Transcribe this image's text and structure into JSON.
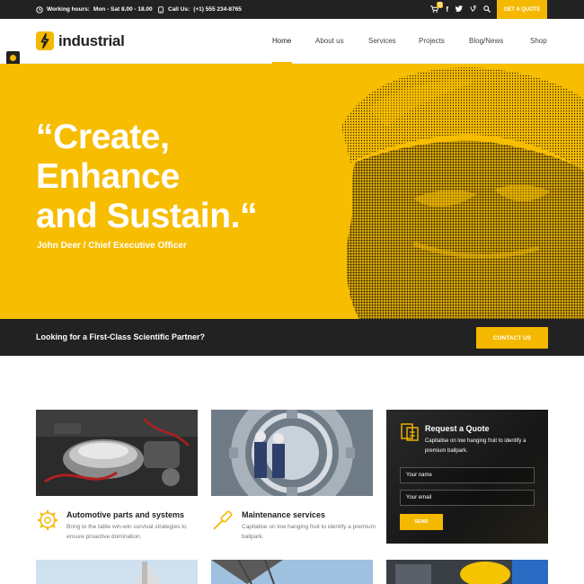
{
  "topbar": {
    "hours_label": "Working hours:",
    "hours_value": "Mon - Sat 8.00 - 18.00",
    "call_label": "Call Us:",
    "call_value": "(+1) 555 234-8765",
    "cart_count": "0",
    "social": [
      "f",
      "t",
      "v"
    ],
    "quote_button": "GET A QUOTE"
  },
  "header": {
    "logo_text": "industrial",
    "nav": [
      "Home",
      "About us",
      "Services",
      "Projects",
      "Blog/News",
      "Shop"
    ]
  },
  "hero": {
    "quote_lines": [
      "“Create,",
      "Enhance",
      "and Sustain.“"
    ],
    "author": "John Deer / Chief Executive Officer"
  },
  "band": {
    "text": "Looking for a First-Class Scientific Partner?",
    "button": "CONTACT US"
  },
  "services": [
    {
      "title": "Automotive parts and systems",
      "desc": "Bring to the table win-win survival strategies to ensure proactive domination."
    },
    {
      "title": "Maintenance services",
      "desc": "Capitalise on low hanging fruit to identify a premium ballpark."
    }
  ],
  "quote_form": {
    "title": "Request a Quote",
    "subtitle": "Capitalise on low hanging fruit to identify a premium ballpark.",
    "name_placeholder": "Your name",
    "email_placeholder": "Your email",
    "send": "SEND"
  },
  "colors": {
    "accent": "#f5b800",
    "dark": "#222222",
    "hero_bg": "#f7bd00"
  }
}
